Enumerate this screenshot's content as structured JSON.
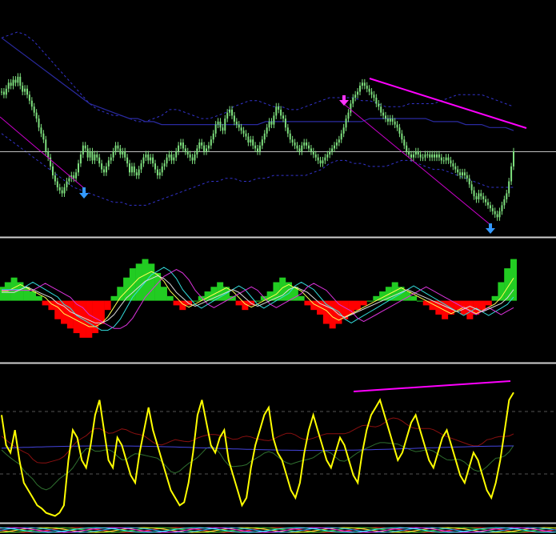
{
  "chart_data": [
    {
      "type": "candlestick",
      "panel": "price",
      "colors": {
        "candle": "#7ee07e",
        "upper_band": "#3333cc",
        "lower_band": "#3333cc",
        "ma": "#2a2aa0",
        "trendline": "#ff00ff",
        "channel": "#cc00cc",
        "arrow_up": "#3399ff",
        "arrow_down": "#ff33ff",
        "crosshair": "#c0c0c0"
      },
      "close": [
        42,
        41,
        43,
        45,
        44,
        46,
        45,
        47,
        44,
        42,
        43,
        41,
        39,
        37,
        35,
        33,
        30,
        28,
        26,
        22,
        20,
        17,
        14,
        12,
        10,
        9,
        8,
        10,
        12,
        13,
        14,
        13,
        15,
        18,
        21,
        24,
        23,
        20,
        22,
        19,
        21,
        20,
        18,
        16,
        15,
        17,
        19,
        20,
        22,
        24,
        23,
        21,
        22,
        20,
        18,
        15,
        17,
        15,
        14,
        16,
        18,
        20,
        21,
        19,
        20,
        18,
        16,
        14,
        15,
        17,
        18,
        20,
        21,
        19,
        20,
        22,
        24,
        25,
        23,
        22,
        21,
        20,
        19,
        21,
        23,
        25,
        24,
        22,
        23,
        24,
        26,
        28,
        31,
        32,
        30,
        29,
        33,
        35,
        36,
        34,
        32,
        31,
        30,
        29,
        28,
        27,
        25,
        26,
        24,
        23,
        22,
        24,
        26,
        28,
        30,
        32,
        31,
        34,
        37,
        36,
        34,
        33,
        30,
        28,
        26,
        25,
        24,
        23,
        22,
        24,
        25,
        24,
        23,
        22,
        21,
        20,
        19,
        18,
        19,
        20,
        21,
        22,
        23,
        24,
        25,
        26,
        28,
        30,
        33,
        35,
        38,
        40,
        41,
        42,
        44,
        45,
        44,
        43,
        42,
        41,
        40,
        38,
        37,
        35,
        34,
        33,
        32,
        33,
        32,
        31,
        30,
        28,
        26,
        24,
        22,
        21,
        20,
        21,
        22,
        21,
        20,
        20,
        21,
        21,
        20,
        21,
        20,
        21,
        20,
        19,
        19,
        20,
        19,
        18,
        17,
        16,
        15,
        14,
        15,
        14,
        13,
        11,
        9,
        7,
        6,
        8,
        7,
        6,
        5,
        4,
        3,
        2,
        1,
        0,
        2,
        4,
        6,
        8,
        12,
        17,
        22
      ],
      "upper_band": [
        60,
        61,
        62,
        61,
        59,
        56,
        53,
        50,
        47,
        44,
        41,
        38,
        36,
        35,
        34,
        34,
        33,
        32,
        32,
        33,
        34,
        36,
        36,
        35,
        34,
        33,
        33,
        34,
        35,
        37,
        38,
        39,
        39,
        38,
        37,
        37,
        36,
        36,
        37,
        38,
        39,
        40,
        40,
        40,
        40,
        39,
        39,
        38,
        37,
        37,
        37,
        38,
        38,
        38,
        38,
        39,
        40,
        41,
        41,
        41,
        41,
        40,
        39,
        38,
        37
      ],
      "lower_band": [
        28,
        26,
        24,
        22,
        20,
        18,
        16,
        14,
        12,
        10,
        9,
        8,
        7,
        6,
        5,
        5,
        4,
        4,
        4,
        5,
        6,
        7,
        8,
        9,
        10,
        11,
        12,
        12,
        13,
        13,
        12,
        12,
        13,
        13,
        14,
        14,
        14,
        14,
        14,
        15,
        16,
        18,
        19,
        19,
        18,
        18,
        17,
        17,
        17,
        18,
        19,
        19,
        18,
        17,
        16,
        16,
        15,
        14,
        13,
        12,
        11,
        10,
        10,
        10,
        10
      ],
      "ma": [
        60,
        58,
        56,
        54,
        52,
        50,
        48,
        46,
        44,
        42,
        40,
        38,
        37,
        36,
        35,
        34,
        33,
        33,
        32,
        32,
        31,
        31,
        31,
        31,
        31,
        31,
        31,
        31,
        31,
        31,
        31,
        31,
        31,
        32,
        32,
        32,
        32,
        32,
        32,
        32,
        32,
        32,
        32,
        32,
        32,
        32,
        33,
        33,
        33,
        33,
        33,
        33,
        33,
        33,
        32,
        32,
        32,
        32,
        31,
        31,
        31,
        30,
        30,
        30,
        29
      ],
      "ylim": [
        -5,
        70
      ]
    },
    {
      "type": "histogram",
      "panel": "oscillator",
      "colors": {
        "positive": "#22cc22",
        "negative": "#ff0000",
        "line_yellow": "#ffff55",
        "line_cyan": "#33dddd",
        "line_magenta": "#dd33dd",
        "line_white": "#dddddd"
      },
      "values": [
        3,
        4,
        5,
        4,
        3,
        2,
        1,
        -1,
        -2,
        -4,
        -5,
        -6,
        -7,
        -8,
        -8,
        -7,
        -5,
        -2,
        1,
        3,
        5,
        7,
        8,
        9,
        8,
        6,
        3,
        1,
        -1,
        -2,
        -1,
        0,
        1,
        2,
        3,
        4,
        3,
        1,
        -1,
        -2,
        -1,
        0,
        1,
        2,
        4,
        5,
        4,
        3,
        1,
        -1,
        -2,
        -3,
        -5,
        -6,
        -5,
        -4,
        -3,
        -2,
        -1,
        0,
        1,
        2,
        3,
        4,
        3,
        2,
        1,
        0,
        -1,
        -2,
        -3,
        -4,
        -3,
        -2,
        -3,
        -4,
        -3,
        -2,
        -1,
        1,
        4,
        7,
        9
      ],
      "ylim": [
        -12,
        11
      ]
    },
    {
      "type": "line",
      "panel": "rsi",
      "colors": {
        "main": "#ffff00",
        "dark_red": "#8b1010",
        "dark_green": "#2f6f2f",
        "blue": "#4444dd",
        "level_dash": "#555555",
        "trendline": "#ff00ff"
      },
      "main": [
        70,
        50,
        45,
        60,
        40,
        25,
        20,
        15,
        10,
        8,
        5,
        4,
        3,
        5,
        10,
        40,
        60,
        55,
        40,
        35,
        50,
        70,
        80,
        60,
        40,
        35,
        55,
        50,
        40,
        30,
        25,
        45,
        60,
        75,
        60,
        50,
        40,
        30,
        20,
        15,
        10,
        12,
        25,
        45,
        70,
        80,
        65,
        50,
        45,
        55,
        60,
        40,
        30,
        20,
        10,
        15,
        35,
        50,
        60,
        70,
        75,
        55,
        45,
        40,
        30,
        20,
        15,
        25,
        45,
        60,
        70,
        60,
        50,
        40,
        35,
        45,
        55,
        50,
        40,
        30,
        25,
        45,
        60,
        70,
        75,
        80,
        70,
        60,
        50,
        40,
        45,
        55,
        65,
        70,
        60,
        50,
        40,
        35,
        45,
        55,
        60,
        50,
        40,
        30,
        25,
        35,
        45,
        40,
        30,
        20,
        15,
        25,
        40,
        60,
        80,
        85
      ],
      "ylim": [
        0,
        100
      ]
    }
  ]
}
